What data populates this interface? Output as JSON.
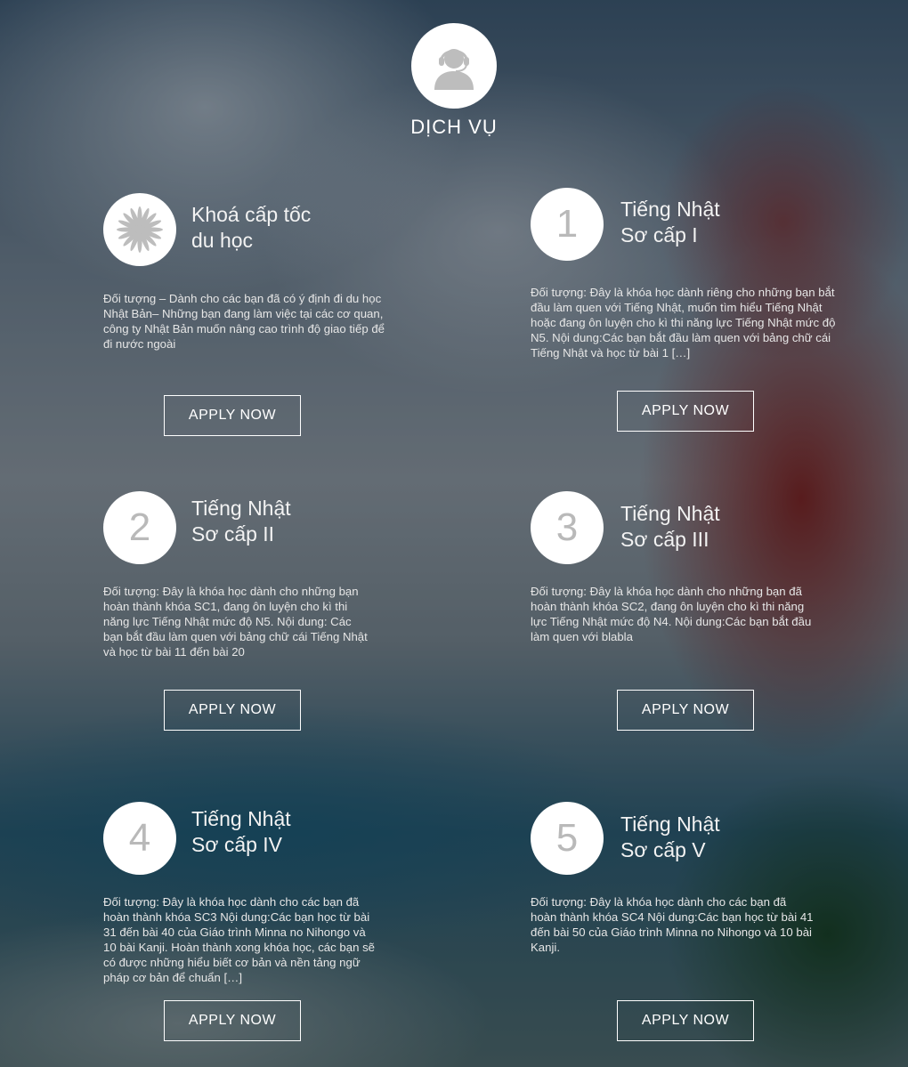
{
  "header": {
    "title": "DỊCH VỤ",
    "icon": "support-agent-icon"
  },
  "courses": [
    {
      "badge": "",
      "badge_icon": "flower-icon",
      "title_line1": "Khoá cấp tốc",
      "title_line2": "du học",
      "description": "Đối tượng – Dành cho các bạn đã có ý định đi du học Nhật Bản– Những bạn đang làm việc tại các cơ quan, công ty Nhật Bản muốn nâng cao trình độ giao tiếp để đi nước ngoài",
      "button": "APPLY NOW"
    },
    {
      "badge": "1",
      "title_line1": "Tiếng Nhật",
      "title_line2": "Sơ cấp I",
      "description": "Đối tượng: Đây là khóa học dành riêng cho những bạn bắt đầu làm quen với Tiếng Nhật, muốn tìm hiểu Tiếng Nhật hoặc đang ôn luyện cho kì thi năng lực Tiếng Nhật mức độ N5. Nội dung:Các bạn bắt đầu làm quen với bảng chữ cái Tiếng Nhật và học từ bài 1 […]",
      "button": "APPLY NOW"
    },
    {
      "badge": "2",
      "title_line1": "Tiếng Nhật",
      "title_line2": "Sơ cấp II",
      "description": "Đối tượng: Đây là khóa học dành cho những bạn hoàn thành khóa SC1, đang ôn luyện cho kì thi năng lực Tiếng Nhật mức độ N5. Nội dung: Các bạn bắt đầu làm quen với bảng chữ cái Tiếng Nhật và học từ bài 11 đến bài 20",
      "button": "APPLY NOW"
    },
    {
      "badge": "3",
      "title_line1": "Tiếng Nhật",
      "title_line2": "Sơ cấp III",
      "description": "Đối tượng: Đây là khóa học dành cho những bạn đã hoàn thành khóa SC2, đang ôn luyện cho kì thi năng lực Tiếng Nhật mức độ N4. Nội dung:Các bạn bắt đầu làm quen với blabla",
      "button": "APPLY NOW"
    },
    {
      "badge": "4",
      "title_line1": "Tiếng Nhật",
      "title_line2": "Sơ cấp IV",
      "description": "Đối tượng: Đây là khóa học dành cho các bạn đã hoàn thành khóa SC3 Nội dung:Các bạn học từ bài 31 đến bài 40 của Giáo trình Minna no Nihongo và 10 bài Kanji. Hoàn thành xong khóa học, các bạn sẽ có được những hiểu biết cơ bản và nền tảng ngữ pháp cơ bản để chuẩn […]",
      "button": "APPLY NOW"
    },
    {
      "badge": "5",
      "title_line1": "Tiếng Nhật",
      "title_line2": "Sơ cấp V",
      "description": "Đối tượng: Đây là khóa học dành cho các bạn đã hoàn thành khóa SC4 Nội dung:Các bạn học từ bài 41 đến bài 50 của Giáo trình Minna no Nihongo và 10 bài Kanji.",
      "button": "APPLY NOW"
    }
  ]
}
